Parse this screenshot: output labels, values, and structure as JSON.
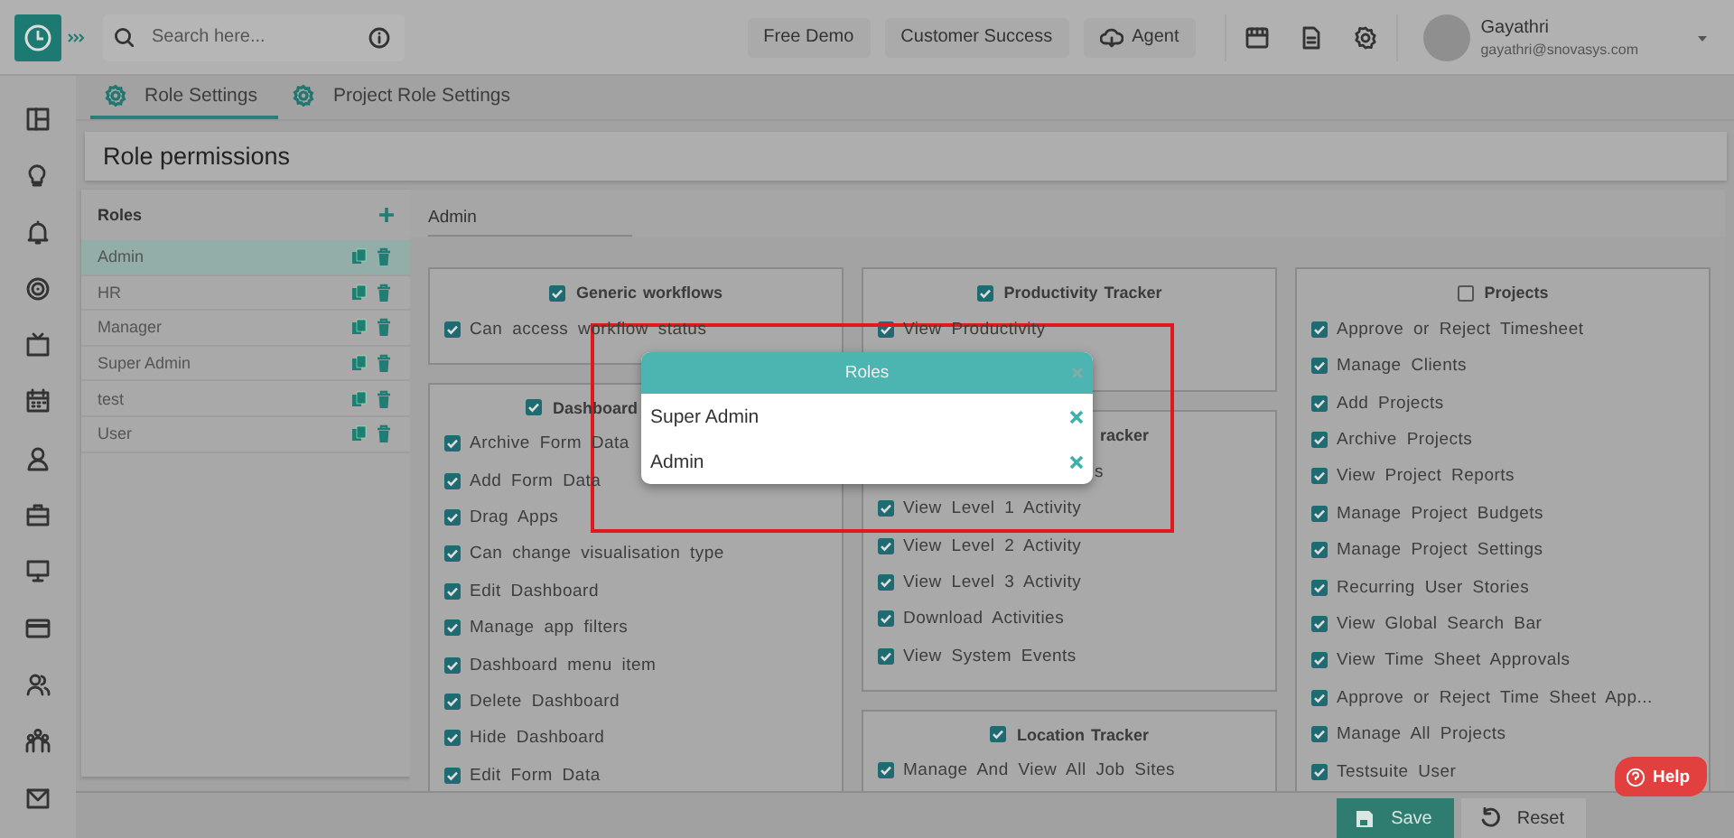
{
  "header": {
    "search": {
      "placeholder": "Search here..."
    },
    "buttons": [
      {
        "label": "Free Demo",
        "kind": "plain"
      },
      {
        "label": "Customer Success",
        "kind": "plain"
      },
      {
        "label": "Agent",
        "kind": "cloud"
      }
    ],
    "user": {
      "name": "Gayathri",
      "email": "gayathri@snovasys.com"
    }
  },
  "tabs": [
    {
      "label": "Role Settings",
      "selected": true
    },
    {
      "label": "Project Role Settings",
      "selected": false
    }
  ],
  "page_title": "Role permissions",
  "roles": {
    "title": "Roles",
    "items": [
      {
        "name": "Admin",
        "selected": true
      },
      {
        "name": "HR",
        "selected": false
      },
      {
        "name": "Manager",
        "selected": false
      },
      {
        "name": "Super Admin",
        "selected": false
      },
      {
        "name": "test",
        "selected": false
      },
      {
        "name": "User",
        "selected": false
      }
    ]
  },
  "role_name": {
    "value": "Admin"
  },
  "columns": [
    {
      "boxes": [
        {
          "title": "Generic workflows",
          "checked": true,
          "items": [
            {
              "label": "Can access workflow status",
              "checked": true
            }
          ]
        },
        {
          "title": "Dashboard",
          "checked": true,
          "items": [
            {
              "label": "Archive Form Data",
              "checked": true
            },
            {
              "label": "Add Form Data",
              "checked": true
            },
            {
              "label": "Drag Apps",
              "checked": true
            },
            {
              "label": "Can change visualisation type",
              "checked": true
            },
            {
              "label": "Edit Dashboard",
              "checked": true
            },
            {
              "label": "Manage app filters",
              "checked": true
            },
            {
              "label": "Dashboard menu item",
              "checked": true
            },
            {
              "label": "Delete Dashboard",
              "checked": true
            },
            {
              "label": "Hide Dashboard",
              "checked": true
            },
            {
              "label": "Edit Form Data",
              "checked": true
            }
          ]
        }
      ]
    },
    {
      "boxes": [
        {
          "title": "Productivity Tracker",
          "checked": true,
          "items": [
            {
              "label": "View Productivity",
              "checked": true
            }
          ]
        },
        {
          "title": "racker",
          "items": [
            {
              "label": "s"
            },
            {
              "label": "View Level 1 Activity",
              "checked": true
            },
            {
              "label": "View Level 2 Activity",
              "checked": true
            },
            {
              "label": "View Level 3 Activity",
              "checked": true
            },
            {
              "label": "Download Activities",
              "checked": true
            },
            {
              "label": "View System Events",
              "checked": true
            }
          ]
        },
        {
          "title": "Location Tracker",
          "checked": true,
          "items": [
            {
              "label": "Manage And View All Job Sites",
              "checked": true
            }
          ]
        }
      ]
    },
    {
      "boxes": [
        {
          "title": "Projects",
          "checked": false,
          "items": [
            {
              "label": "Approve or Reject Timesheet",
              "checked": true
            },
            {
              "label": "Manage Clients",
              "checked": true
            },
            {
              "label": "Add Projects",
              "checked": true
            },
            {
              "label": "Archive Projects",
              "checked": true
            },
            {
              "label": "View Project Reports",
              "checked": true
            },
            {
              "label": "Manage Project Budgets",
              "checked": true
            },
            {
              "label": "Manage Project Settings",
              "checked": true
            },
            {
              "label": "Recurring User Stories",
              "checked": true
            },
            {
              "label": "View Global Search Bar",
              "checked": true
            },
            {
              "label": "View Time Sheet Approvals",
              "checked": true
            },
            {
              "label": "Approve or Reject Time Sheet App...",
              "checked": true
            },
            {
              "label": "Manage All Projects",
              "checked": true
            },
            {
              "label": "Testsuite User",
              "checked": true
            }
          ]
        }
      ]
    }
  ],
  "popup": {
    "title": "Roles",
    "items": [
      {
        "name": "Super Admin"
      },
      {
        "name": "Admin"
      }
    ]
  },
  "footer": {
    "buttons": [
      {
        "label": "Save",
        "kind": "primary"
      },
      {
        "label": "Reset",
        "kind": "secondary"
      }
    ]
  },
  "help": {
    "label": "Help"
  }
}
